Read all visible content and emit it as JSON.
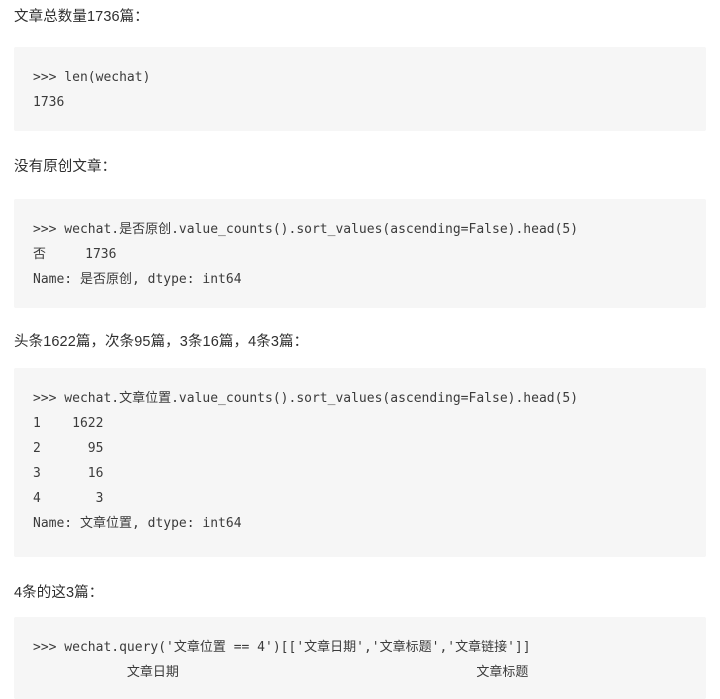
{
  "document": {
    "background_color": "#ffffff",
    "code_block_background": "#f6f6f6",
    "text_color": "#2f2f2f",
    "code_text_color": "#3b3b3b"
  },
  "sections": [
    {
      "heading": "文章总数量1736篇：",
      "code_lines": [
        ">>> len(wechat)",
        "1736"
      ]
    },
    {
      "heading": "没有原创文章：",
      "code_lines": [
        ">>> wechat.是否原创.value_counts().sort_values(ascending=False).head(5)",
        "否     1736",
        "Name: 是否原创, dtype: int64"
      ]
    },
    {
      "heading": "头条1622篇，次条95篇，3条16篇，4条3篇：",
      "code_lines": [
        ">>> wechat.文章位置.value_counts().sort_values(ascending=False).head(5)",
        "1    1622",
        "2      95",
        "3      16",
        "4       3",
        "Name: 文章位置, dtype: int64"
      ]
    },
    {
      "heading": "4条的这3篇：",
      "code_lines": [
        ">>> wechat.query('文章位置 == 4')[['文章日期','文章标题','文章链接']]",
        "            文章日期                                      文章标题"
      ]
    }
  ]
}
